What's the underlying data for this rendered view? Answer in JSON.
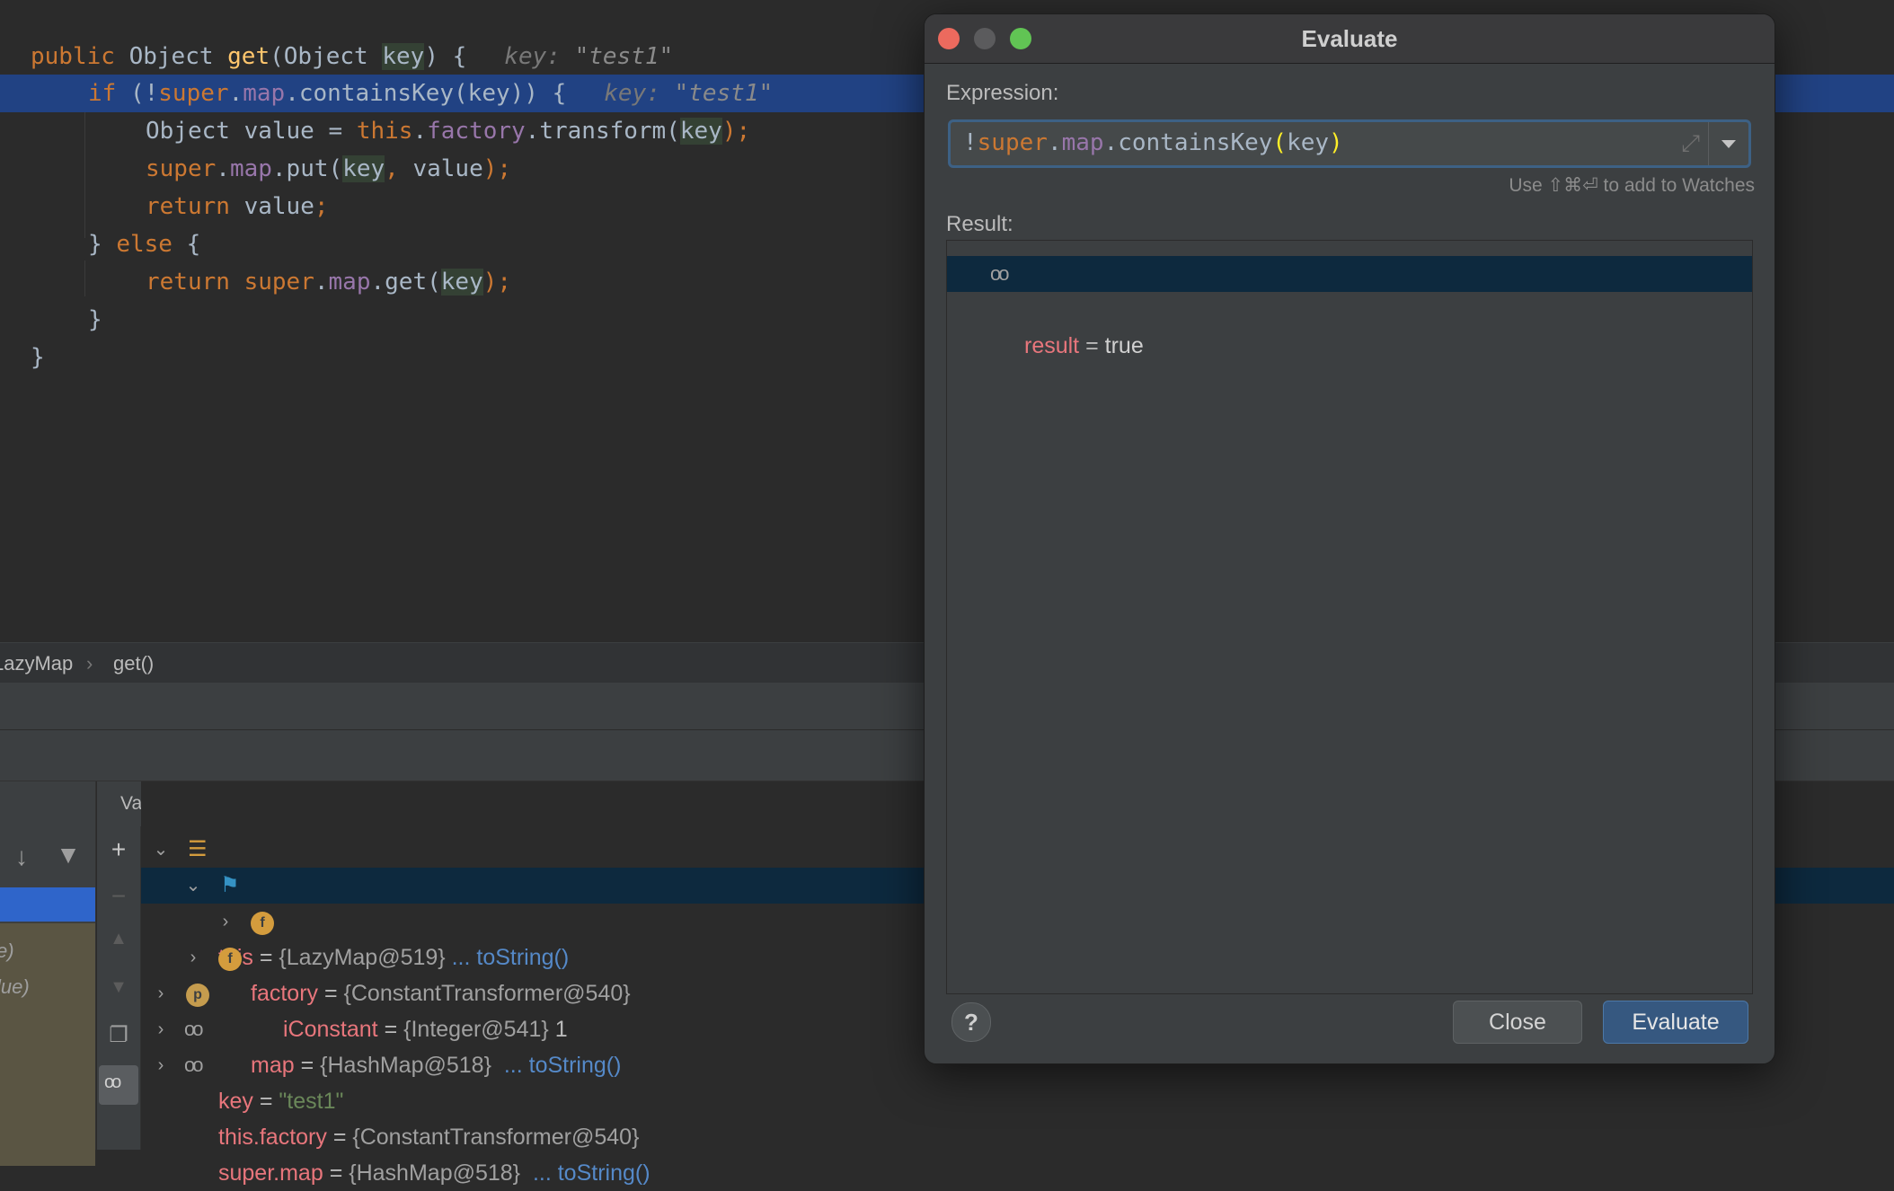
{
  "editor": {
    "line1": {
      "kw": "public",
      "type": " Object ",
      "fn": "get",
      "rest1": "(Object ",
      "param": "key",
      "rest2": ") {",
      "hint_name": "key: ",
      "hint_val": "\"test1\""
    },
    "line2": {
      "kw": "if",
      "p1": " (!",
      "super": "super",
      "dot": ".",
      "map": "map",
      "call": ".containsKey(key)) {",
      "hint_name": "key: ",
      "hint_val": "\"test1\""
    },
    "line3": {
      "p1": "Object value = ",
      "this": "this",
      "dot": ".",
      "factory": "factory",
      "call": ".transform(",
      "key": "key",
      "end": ");"
    },
    "line4": {
      "super": "super",
      "dot": ".",
      "map": "map",
      "call": ".put(",
      "key": "key",
      "comma": ",",
      "rest": " value",
      "end": ");"
    },
    "line5": {
      "kw": "return",
      "rest": " value",
      "end": ";"
    },
    "line6": {
      "brace": "} ",
      "kw": "else",
      "rest": " {"
    },
    "line7": {
      "kw": "return",
      "sp": " ",
      "super": "super",
      "dot": ".",
      "map": "map",
      "call": ".get(",
      "key": "key",
      "end": ");"
    },
    "line8": {
      "text": "}"
    },
    "line9": {
      "text": "}"
    }
  },
  "breadcrumb": {
    "class": "LazyMap",
    "sep": "›",
    "method": "get()"
  },
  "variables": {
    "header": "Variables",
    "rows": [
      {
        "name": "this",
        "eq": " = ",
        "val": "{LazyMap@519}",
        "link": "... toString()"
      },
      {
        "name": "factory",
        "eq": " = ",
        "val": "{ConstantTransformer@540}"
      },
      {
        "name": "iConstant",
        "eq": " = ",
        "val": "{Integer@541}",
        "extra": "1"
      },
      {
        "name": "map",
        "eq": " = ",
        "val": "{HashMap@518}",
        "link": "... toString()"
      },
      {
        "name": "key",
        "eq": " = ",
        "val": "\"test1\""
      },
      {
        "name": "this.factory",
        "eq": " = ",
        "val": "{ConstantTransformer@540}"
      },
      {
        "name": "super.map",
        "eq": " = ",
        "val": "{HashMap@518}",
        "link": "... toString()"
      }
    ]
  },
  "frames": {
    "item1": "e)",
    "item2": "lue)"
  },
  "dialog": {
    "title": "Evaluate",
    "expression_label": "Expression:",
    "expression": {
      "bang": "!",
      "super": "super",
      "dot1": ".",
      "map": "map",
      "dot2": ".",
      "call": "containsKey",
      "lp": "(",
      "key": "key",
      "rp": ")"
    },
    "watch_hint": "Use ⇧⌘⏎ to add to Watches",
    "result_label": "Result:",
    "result": {
      "name": "result",
      "eq": " = ",
      "val": "true"
    },
    "help": "?",
    "close_label": "Close",
    "evaluate_label": "Evaluate"
  },
  "icons": [
    "close-icon",
    "minimize-icon",
    "maximize-icon",
    "expand-icon",
    "dropdown-icon",
    "glasses-icon",
    "help-icon",
    "field-icon",
    "param-icon",
    "flag-icon",
    "object-icon",
    "chevron-down-icon",
    "chevron-right-icon",
    "add-icon",
    "remove-icon",
    "filter-icon",
    "step-down-icon",
    "copy-icon"
  ],
  "colors": {
    "accent": "#2f65ca",
    "highlight_line": "#214283",
    "selection": "#0d293e",
    "keyword": "#cc7832",
    "field": "#9876aa",
    "method": "#ffc66d",
    "var_name": "#e8767c"
  }
}
